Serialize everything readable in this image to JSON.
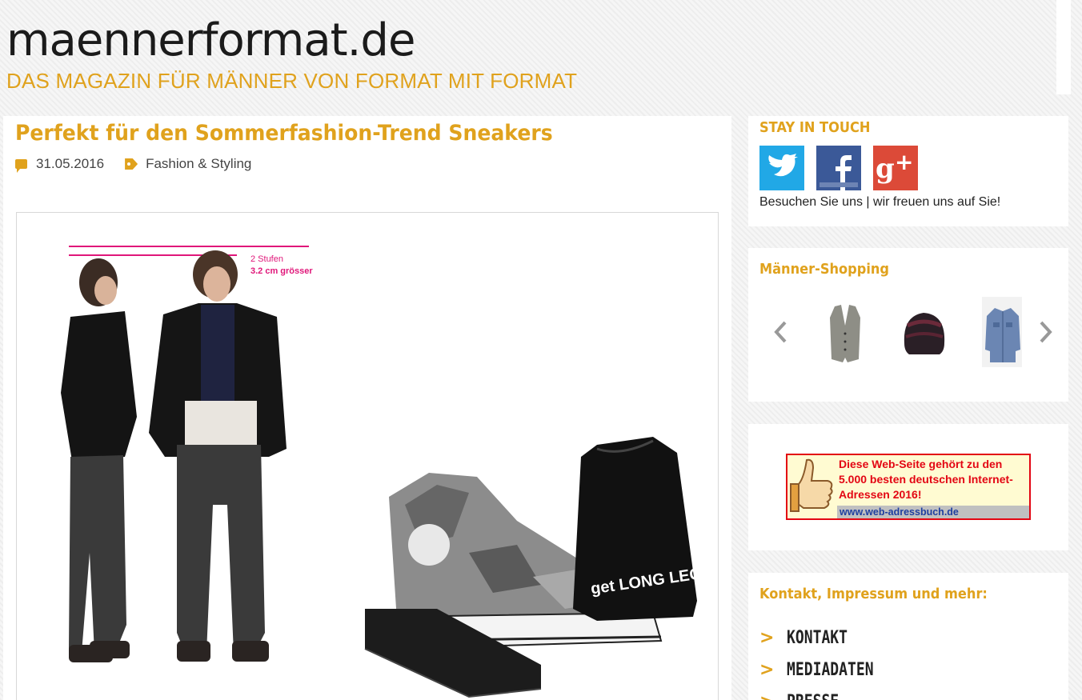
{
  "header": {
    "site_title": "maennerformat.de",
    "tagline": "DAS MAGAZIN FÜR MÄNNER VON FORMAT MIT FORMAT"
  },
  "post": {
    "title": "Perfekt für den Sommerfashion-Trend Sneakers",
    "date": "31.05.2016",
    "category": "Fashion & Styling",
    "image_annotation": {
      "line1": "2 Stufen",
      "line2": "3.2 cm grösser"
    },
    "bag_text": "get LONG LEGS"
  },
  "sidebar": {
    "stay_in_touch": {
      "title": "STAY IN TOUCH",
      "note": "Besuchen Sie uns | wir freuen uns auf Sie!",
      "networks": [
        "twitter-icon",
        "facebook-icon",
        "google-plus-icon"
      ]
    },
    "shopping": {
      "title": "Männer-Shopping",
      "products": [
        "vest",
        "beanie",
        "denim-shirt"
      ]
    },
    "badge": {
      "text": "Diese Web-Seite gehört zu den 5.000 besten deutschen Internet-Adressen 2016!",
      "url": "www.web-adressbuch.de"
    },
    "contact": {
      "title": "Kontakt, Impressum und mehr:",
      "links": [
        "KONTAKT",
        "MEDIADATEN",
        "PRESSE"
      ]
    }
  },
  "colors": {
    "accent": "#e0a21d",
    "twitter": "#21a8e6",
    "facebook": "#3b5998",
    "gplus": "#dc4a38",
    "annotation": "#e0177a"
  }
}
